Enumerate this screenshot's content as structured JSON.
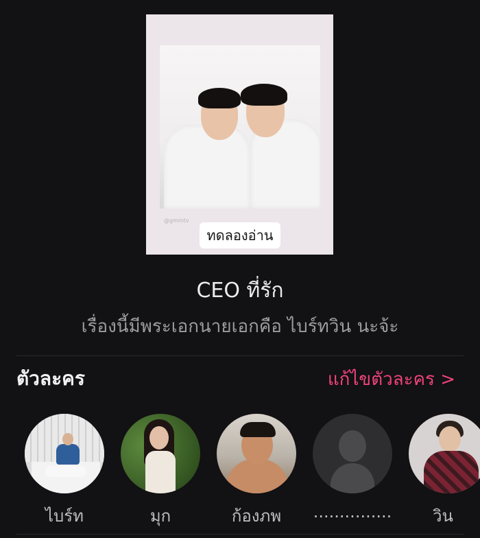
{
  "cover": {
    "watermark": "@gmmtv",
    "try_read_label": "ทดลองอ่าน"
  },
  "story": {
    "title": "CEO ที่รัก",
    "subtitle": "เรื่องนี้มีพระเอกนายเอกคือ ไบร์ทวิน นะจ้ะ"
  },
  "characters_section": {
    "title": "ตัวละคร",
    "edit_label": "แก้ไขตัวละคร >",
    "accent_color": "#f0437a",
    "characters": [
      {
        "name": "ไบร์ท",
        "avatar": "photo"
      },
      {
        "name": "มุก",
        "avatar": "photo"
      },
      {
        "name": "ก้องภพ",
        "avatar": "photo"
      },
      {
        "name": "...............",
        "avatar": "default-person-icon"
      },
      {
        "name": "วิน",
        "avatar": "photo"
      }
    ]
  }
}
